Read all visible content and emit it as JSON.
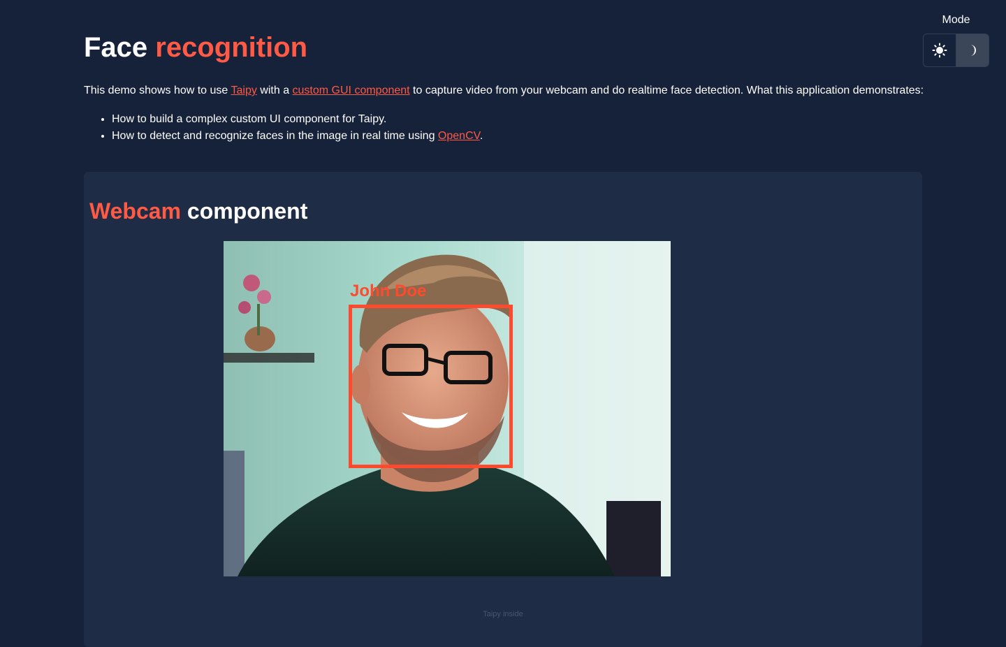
{
  "mode": {
    "label": "Mode",
    "options": [
      {
        "name": "light",
        "icon": "sun-icon",
        "selected": false
      },
      {
        "name": "dark",
        "icon": "moon-icon",
        "selected": true
      }
    ]
  },
  "header": {
    "title_part1": "Face",
    "title_part2": "recognition"
  },
  "intro": {
    "text_before": "This demo shows how to use ",
    "link_taipy": "Taipy",
    "text_middle": " with a ",
    "link_component": "custom GUI component",
    "text_after": " to capture video from your webcam and do realtime face detection. What this application demonstrates:"
  },
  "bullets": {
    "item1": "How to build a complex custom UI component for Taipy.",
    "item2_before": "How to detect and recognize faces in the image in real time using ",
    "item2_link": "OpenCV",
    "item2_after": "."
  },
  "panel": {
    "title_part1": "Webcam",
    "title_part2": "component"
  },
  "webcam": {
    "detected_name": "John Doe"
  },
  "footer": {
    "note": "Taipy inside"
  },
  "colors": {
    "background": "#16213a",
    "panel": "#1f2c45",
    "accent": "#ff5a45",
    "detection_box": "#ff4a2e"
  }
}
